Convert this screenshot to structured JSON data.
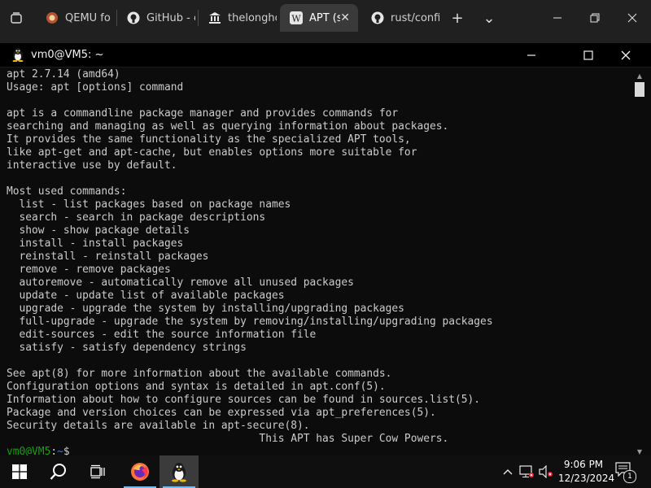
{
  "browser": {
    "tabs": [
      {
        "label": "QEMU fo",
        "icon": "qemu-icon",
        "active": false
      },
      {
        "label": "GitHub - c",
        "icon": "github-icon",
        "active": false
      },
      {
        "label": "thelonghc",
        "icon": "bank-icon",
        "active": false
      },
      {
        "label": "APT (so",
        "icon": "wikipedia-icon",
        "active": true
      },
      {
        "label": "rust/confi",
        "icon": "github-icon",
        "active": false
      }
    ],
    "new_tab_glyph": "+",
    "tab_list_glyph": "⌄"
  },
  "terminal": {
    "title": "vm0@VM5: ~",
    "output_lines": [
      "apt 2.7.14 (amd64)",
      "Usage: apt [options] command",
      "",
      "apt is a commandline package manager and provides commands for",
      "searching and managing as well as querying information about packages.",
      "It provides the same functionality as the specialized APT tools,",
      "like apt-get and apt-cache, but enables options more suitable for",
      "interactive use by default.",
      "",
      "Most used commands:",
      "  list - list packages based on package names",
      "  search - search in package descriptions",
      "  show - show package details",
      "  install - install packages",
      "  reinstall - reinstall packages",
      "  remove - remove packages",
      "  autoremove - automatically remove all unused packages",
      "  update - update list of available packages",
      "  upgrade - upgrade the system by installing/upgrading packages",
      "  full-upgrade - upgrade the system by removing/installing/upgrading packages",
      "  edit-sources - edit the source information file",
      "  satisfy - satisfy dependency strings",
      "",
      "See apt(8) for more information about the available commands.",
      "Configuration options and syntax is detailed in apt.conf(5).",
      "Information about how to configure sources can be found in sources.list(5).",
      "Package and version choices can be expressed via apt_preferences(5).",
      "Security details are available in apt-secure(8).",
      "                                        This APT has Super Cow Powers."
    ],
    "prompt": {
      "user_host": "vm0@VM5",
      "separator": ":",
      "path": "~",
      "symbol": "$"
    },
    "colors": {
      "background": "#0c0c0c",
      "text": "#cccccc",
      "prompt_user": "#13a10e",
      "prompt_path": "#3b78ff"
    }
  },
  "taskbar": {
    "items": [
      {
        "name": "start-button",
        "icon": "windows-logo-icon"
      },
      {
        "name": "search-button",
        "icon": "search-icon"
      },
      {
        "name": "task-view-button",
        "icon": "task-view-icon"
      },
      {
        "name": "firefox-taskbar-item",
        "icon": "firefox-icon"
      },
      {
        "name": "terminal-taskbar-item",
        "icon": "tux-icon",
        "active": true
      }
    ],
    "time": "9:06 PM",
    "date": "12/23/2024",
    "notification_count": "1",
    "accent": "#76b9ed"
  }
}
